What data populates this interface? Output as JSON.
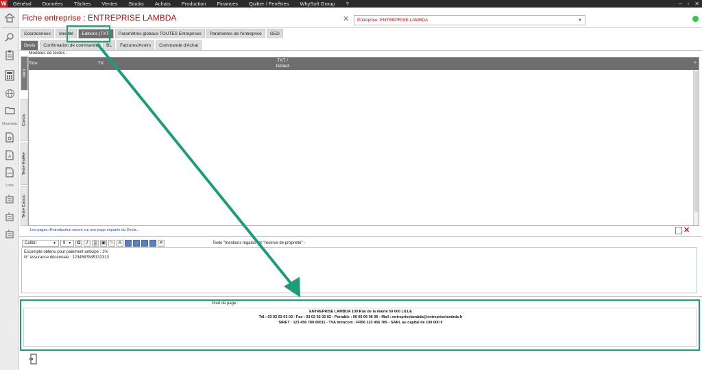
{
  "menubar": {
    "logo": "W",
    "items": [
      "Général",
      "Données",
      "Tâches",
      "Ventes",
      "Stocks",
      "Achats",
      "Production",
      "Finances",
      "Quitter / Fenêtres",
      "WhySoft Group",
      "?"
    ],
    "window_controls": [
      "–",
      "▫",
      "✕"
    ]
  },
  "sidebar": {
    "nouveau_label": "Nouveau",
    "liste_label": "Liste"
  },
  "header": {
    "title": "Fiche entreprise : ENTREPRISE LAMBDA",
    "close_glyph": "✕",
    "entity_value": "Entreprise :ENTREPRISE LAMBDA",
    "status_color": "#2ecc40"
  },
  "tabs": [
    {
      "label": "Coordonnées"
    },
    {
      "label": "Identité"
    },
    {
      "label": "Editions (TXT)"
    },
    {
      "label": "Paramètres globaux TOUTES Entreprises"
    },
    {
      "label": "Paramètres de l'entreprise"
    },
    {
      "label": "GED"
    }
  ],
  "subtabs": [
    {
      "label": "Devis"
    },
    {
      "label": "Confirmation de commande"
    },
    {
      "label": "BL"
    },
    {
      "label": "Factures/Avoirs"
    },
    {
      "label": "Commande d'Achat"
    }
  ],
  "vtabs": [
    {
      "label": "Intro"
    },
    {
      "label": "Conclu"
    },
    {
      "label": "Texte Entête"
    },
    {
      "label": "Texte Conclu"
    }
  ],
  "models_label": "Modèles de textes :",
  "grid": {
    "col_titre": "Titre",
    "col_tx": "TX",
    "col_txt_line1": "TXT /",
    "col_txt_line2": "Défaut"
  },
  "intro_note": "Les pages d'Introduction seront sur une page séparée du Devis...",
  "editor": {
    "font": "Calibri",
    "size": "9",
    "mentions_label": "Texte \"mentions légales\" et \"réserve de propriété\" :",
    "text_line1": "Escompte obtenu pour paiement anticipé : 1%",
    "text_line2": "N° assurance décennale : 1234567845132313"
  },
  "footer": {
    "label": "Pied de page :",
    "line1": "ENTREPRISE LAMBDA 100 Rue de la mairie 59 000 LILLE",
    "line2": "Tél : 03 03 03 03 03  -  Fax : 03 02 02 02 02 - Portable : 06 06 06 06 06 - Mail : entrepriselambda@entrepriselambda.fr",
    "line3": "SIRET : 123 456 789 00011 - TVA Intracom : FR56 123 456 789 - SARL au capital de 100 000 €"
  },
  "annotation_color": "#1a9e7a"
}
